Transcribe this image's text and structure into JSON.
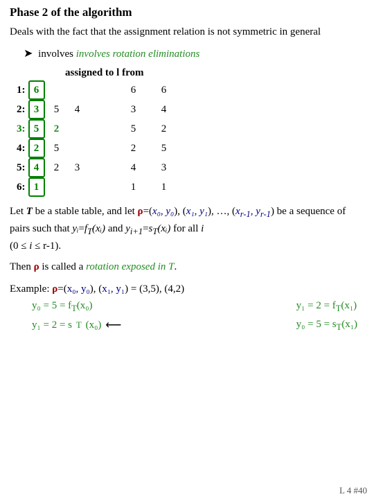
{
  "title": "Phase 2 of the algorithm",
  "intro": "Deals with the fact that the assignment relation is not symmetric in general",
  "bullet": "involves rotation eliminations",
  "assigned_label": "assigned to l from",
  "rows": [
    {
      "label": "1:",
      "highlight": false,
      "cells": [
        {
          "val": "6",
          "boxed": true,
          "green": true
        }
      ],
      "extra": [],
      "right1": "6",
      "right2": "6"
    },
    {
      "label": "2:",
      "highlight": false,
      "cells": [
        {
          "val": "3",
          "boxed": true,
          "green": true
        }
      ],
      "extra": [
        "5",
        "4"
      ],
      "right1": "3",
      "right2": "4"
    },
    {
      "label": "3:",
      "highlight": true,
      "cells": [
        {
          "val": "5",
          "boxed": true,
          "green": true
        }
      ],
      "extra": [
        "2"
      ],
      "right1": "5",
      "right2": "2"
    },
    {
      "label": "4:",
      "highlight": false,
      "cells": [
        {
          "val": "2",
          "boxed": true,
          "green": true
        }
      ],
      "extra": [
        "5"
      ],
      "right1": "2",
      "right2": "5"
    },
    {
      "label": "5:",
      "highlight": false,
      "cells": [
        {
          "val": "4",
          "boxed": true,
          "green": true
        }
      ],
      "extra": [
        "2",
        "3"
      ],
      "right1": "4",
      "right2": "3"
    },
    {
      "label": "6:",
      "highlight": false,
      "cells": [
        {
          "val": "1",
          "boxed": true,
          "green": true
        }
      ],
      "extra": [],
      "right1": "1",
      "right2": "1"
    }
  ],
  "stable_table_text1": "Let ",
  "stable_table_T": "T",
  "stable_table_text2": " be a stable table, and let",
  "rho_sequence": "ρ=(x₀, y₀), (x₁, y₁), …, (x",
  "rho_seq_sub": "r-1",
  "rho_seq_end": ", y",
  "rho_seq_sub2": "r-1",
  "rho_seq_close": ")",
  "stable_text3": " be a sequence of pairs such that ",
  "yi_eq": "yᵢ=f",
  "T_sub": "T",
  "xi_part": "(xᵢ)",
  "and_text": " and ",
  "yi1_eq": "yᵢ₊₁=s",
  "T_sub2": "T",
  "xi_part2": "(xᵢ)",
  "for_all": " for all ",
  "i_italic": "i",
  "range": " (0 ≤ i ≤ r-1).",
  "then_rho": "Then ρ is called a ",
  "rotation_text": "rotation exposed in T",
  "period": ".",
  "example_label": "Example: ",
  "example_rho": "ρ=(x₀, y₀), (x₁, y₁) = (3,5), (4,2)",
  "green_line1_left": "y₀ = 5 = f_T(x₀)",
  "green_line1_right": "y₁ = 2 = f_T(x₁)",
  "green_line2_left": "y₁ = 2 = s_T(x₀)",
  "green_line2_right": "y₀ = 5 = s_T(x₁)",
  "page_num": "L 4 #40"
}
